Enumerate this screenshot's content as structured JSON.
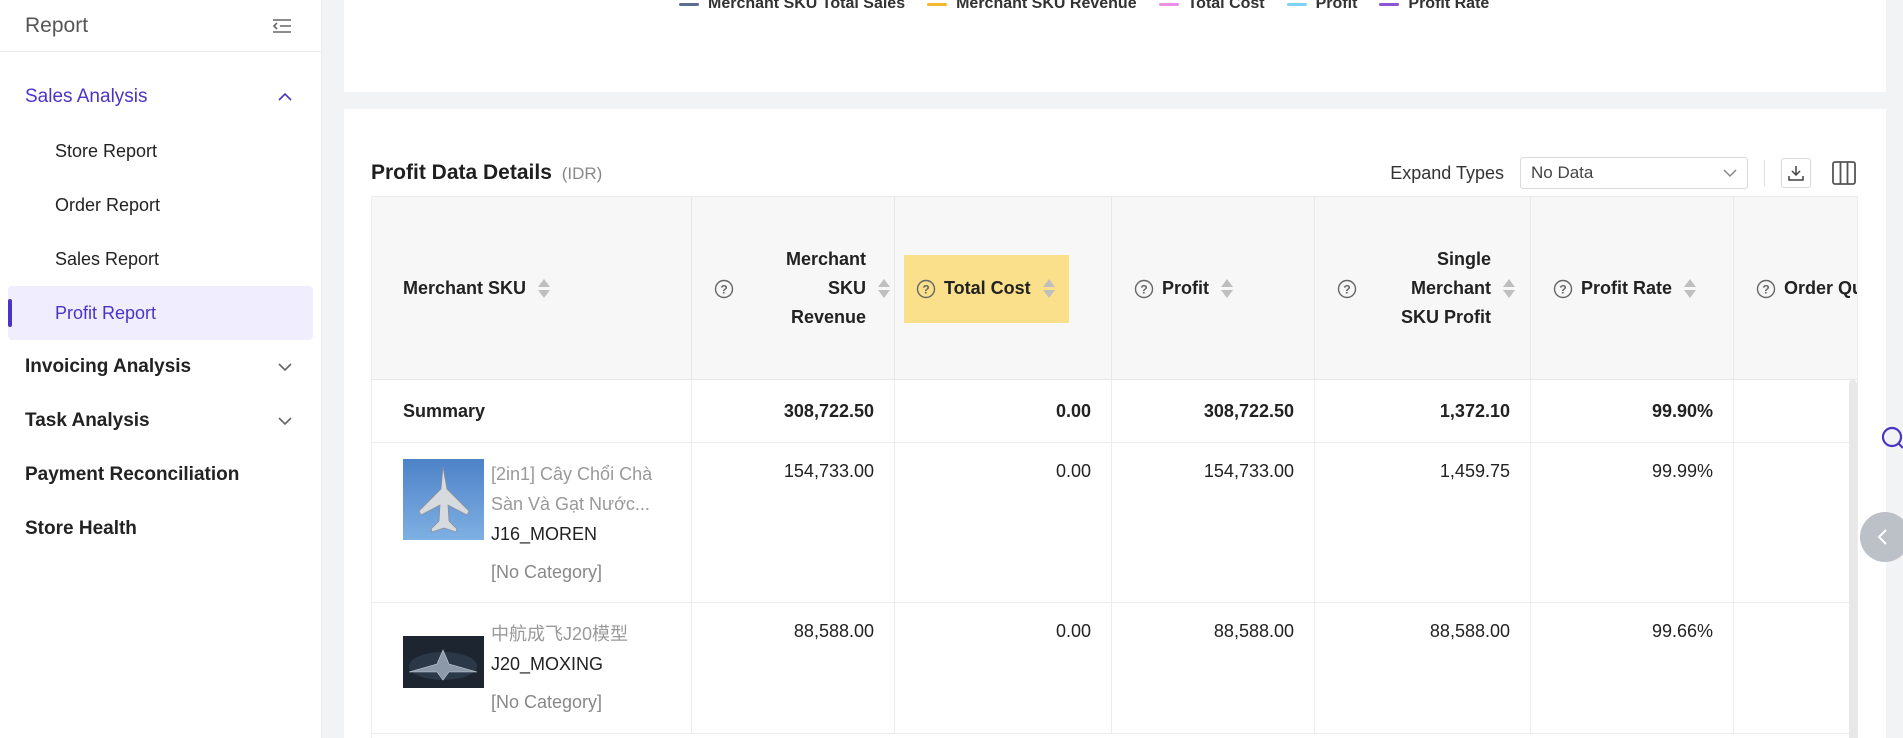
{
  "sidebar": {
    "title": "Report",
    "groups": [
      {
        "label": "Sales Analysis",
        "expanded": true
      },
      {
        "label": "Invoicing Analysis"
      },
      {
        "label": "Task Analysis"
      },
      {
        "label": "Payment Reconciliation"
      },
      {
        "label": "Store Health"
      }
    ],
    "sales_items": [
      "Store Report",
      "Order Report",
      "Sales Report",
      "Profit Report"
    ],
    "selected": "Profit Report"
  },
  "legend": [
    {
      "label": "Merchant SKU Total Sales",
      "color": "#5b6f94"
    },
    {
      "label": "Merchant SKU Revenue",
      "color": "#f5b82e"
    },
    {
      "label": "Total Cost",
      "color": "#e98fe6"
    },
    {
      "label": "Profit",
      "color": "#7fd3f2"
    },
    {
      "label": "Profit Rate",
      "color": "#8e54d6"
    }
  ],
  "details": {
    "title": "Profit Data Details",
    "unit": "(IDR)",
    "expand_label": "Expand Types",
    "expand_value": "No Data"
  },
  "table": {
    "columns": [
      "Merchant SKU",
      "Merchant SKU Revenue",
      "Total Cost",
      "Profit",
      "Single Merchant SKU Profit",
      "Profit Rate",
      "Order Qua"
    ],
    "summary": {
      "label": "Summary",
      "revenue": "308,722.50",
      "cost": "0.00",
      "profit": "308,722.50",
      "single": "1,372.10",
      "rate": "99.90%"
    },
    "rows": [
      {
        "name": "[2in1] Cây Chổi Chà Sàn Và Gạt Nước...",
        "sku": "J16_MOREN",
        "category": "[No Category]",
        "revenue": "154,733.00",
        "cost": "0.00",
        "profit": "154,733.00",
        "single": "1,459.75",
        "rate": "99.99%"
      },
      {
        "name": "中航成飞J20模型",
        "sku": "J20_MOXING",
        "category": "[No Category]",
        "revenue": "88,588.00",
        "cost": "0.00",
        "profit": "88,588.00",
        "single": "88,588.00",
        "rate": "99.66%"
      }
    ]
  },
  "colors": {
    "accent": "#4a34c6",
    "highlight": "#fae08a"
  }
}
